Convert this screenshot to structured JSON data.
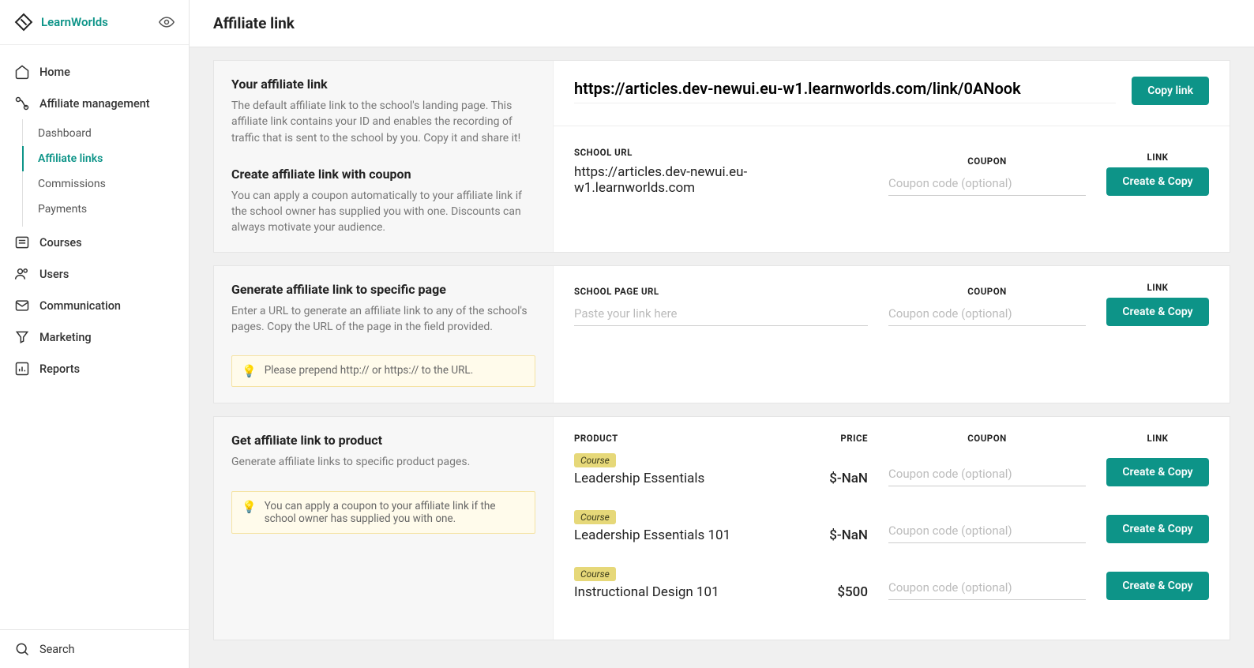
{
  "brand": "LearnWorlds",
  "nav": {
    "home": "Home",
    "affiliate_mgmt": "Affiliate management",
    "sub": {
      "dashboard": "Dashboard",
      "affiliate_links": "Affiliate links",
      "commissions": "Commissions",
      "payments": "Payments"
    },
    "courses": "Courses",
    "users": "Users",
    "communication": "Communication",
    "marketing": "Marketing",
    "reports": "Reports",
    "search": "Search"
  },
  "page": {
    "title": "Affiliate link"
  },
  "section1": {
    "title": "Your affiliate link",
    "desc": "The default affiliate link to the school's landing page. This affiliate link contains your ID and enables the recording of traffic that is sent to the school by you. Copy it and share it!",
    "title2": "Create affiliate link with coupon",
    "desc2": "You can apply a coupon automatically to your affiliate link if the school owner has supplied you with one. Discounts can always motivate your audience.",
    "link": "https://articles.dev-newui.eu-w1.learnworlds.com/link/0ANook",
    "copy_btn": "Copy link",
    "school_url_label": "SCHOOL URL",
    "school_url": "https://articles.dev-newui.eu-w1.learnworlds.com",
    "coupon_label": "COUPON",
    "coupon_placeholder": "Coupon code (optional)",
    "link_label": "LINK",
    "create_copy_btn": "Create & Copy"
  },
  "section2": {
    "title": "Generate affiliate link to specific page",
    "desc": "Enter a URL to generate an affiliate link to any of the school's pages. Copy the URL of the page in the field provided.",
    "tip": "Please prepend http:// or https:// to the URL.",
    "page_url_label": "SCHOOL PAGE URL",
    "page_url_placeholder": "Paste your link here",
    "coupon_label": "COUPON",
    "coupon_placeholder": "Coupon code (optional)",
    "link_label": "LINK",
    "create_copy_btn": "Create & Copy"
  },
  "section3": {
    "title": "Get affiliate link to product",
    "desc": "Generate affiliate links to specific product pages.",
    "tip": "You can apply a coupon to your affiliate link if the school owner has supplied you with one.",
    "headers": {
      "product": "PRODUCT",
      "price": "PRICE",
      "coupon": "COUPON",
      "link": "LINK"
    },
    "coupon_placeholder": "Coupon code (optional)",
    "create_copy_btn": "Create & Copy",
    "products": [
      {
        "badge": "Course",
        "name": "Leadership Essentials",
        "price": "$-NaN"
      },
      {
        "badge": "Course",
        "name": "Leadership Essentials 101",
        "price": "$-NaN"
      },
      {
        "badge": "Course",
        "name": "Instructional Design 101",
        "price": "$500"
      }
    ]
  }
}
